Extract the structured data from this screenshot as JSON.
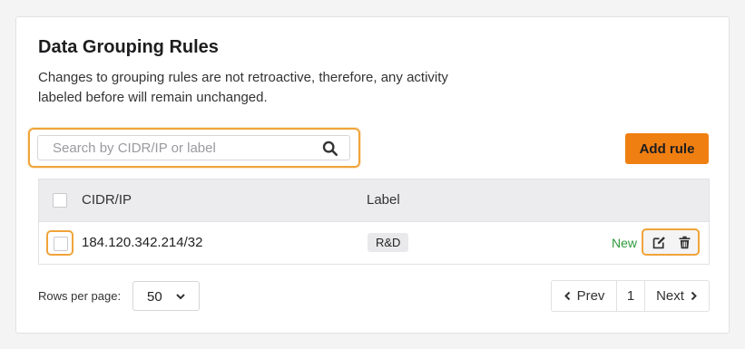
{
  "panel": {
    "title": "Data Grouping Rules",
    "description": "Changes to grouping rules are not retroactive, therefore, any activity labeled before will remain unchanged."
  },
  "search": {
    "placeholder": "Search by CIDR/IP or label",
    "value": ""
  },
  "add_rule_button": {
    "label": "Add rule",
    "color": "#f07f12"
  },
  "table": {
    "columns": {
      "cidr": "CIDR/IP",
      "label": "Label"
    },
    "rows": [
      {
        "cidr": "184.120.342.214/32",
        "label": "R&D",
        "status": "New",
        "status_color": "#2e9a3a",
        "actions": [
          "edit-icon",
          "trash-icon"
        ]
      }
    ]
  },
  "pagination": {
    "rows_per_page_label": "Rows per page:",
    "rows_per_page_value": "50",
    "prev_label": "Prev",
    "current_page": "1",
    "next_label": "Next"
  },
  "colors": {
    "accent": "#f07f12",
    "focus_ring": "#f0a43a",
    "header_bg": "#ececee"
  }
}
